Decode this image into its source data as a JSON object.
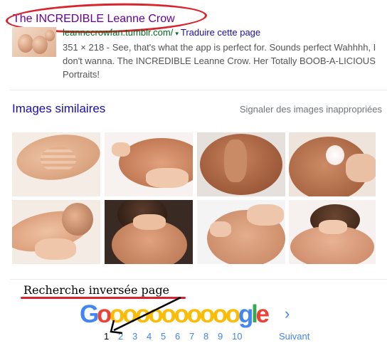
{
  "result": {
    "title": "The INCREDIBLE Leanne Crow",
    "url": "leannecrowfan.tumblr.com/",
    "url_arrow": "▾",
    "translate": "Traduire cette page",
    "snippet": "351 × 218 - See, that's what the app is perfect for. Sounds perfect Wahhhh, I don't wanna. The INCREDIBLE Leanne Crow. Her Totally BOOB-A-LICIOUS Portraits!"
  },
  "similar": {
    "heading": "Images similaires",
    "report": "Signaler des images inappropriées"
  },
  "annotation": {
    "label": "Recherche inversée page"
  },
  "pagination": {
    "logo_letters": [
      "G",
      "o",
      "o",
      "o",
      "o",
      "o",
      "o",
      "o",
      "o",
      "o",
      "o",
      "o",
      "g",
      "l",
      "e"
    ],
    "logo_colors": [
      "#4285f4",
      "#ea4335",
      "#fbbc05",
      "#fbbc05",
      "#fbbc05",
      "#fbbc05",
      "#fbbc05",
      "#fbbc05",
      "#fbbc05",
      "#fbbc05",
      "#fbbc05",
      "#fbbc05",
      "#4285f4",
      "#34a853",
      "#ea4335"
    ],
    "pages": [
      "1",
      "2",
      "3",
      "4",
      "5",
      "6",
      "7",
      "8",
      "9",
      "10"
    ],
    "current_page": "1",
    "next_chevron": "›",
    "next_label": "Suivant"
  },
  "colors": {
    "title_purple": "#660099",
    "link_blue": "#1a0dab",
    "url_green": "#006621",
    "annotation_red": "#d8242b"
  }
}
